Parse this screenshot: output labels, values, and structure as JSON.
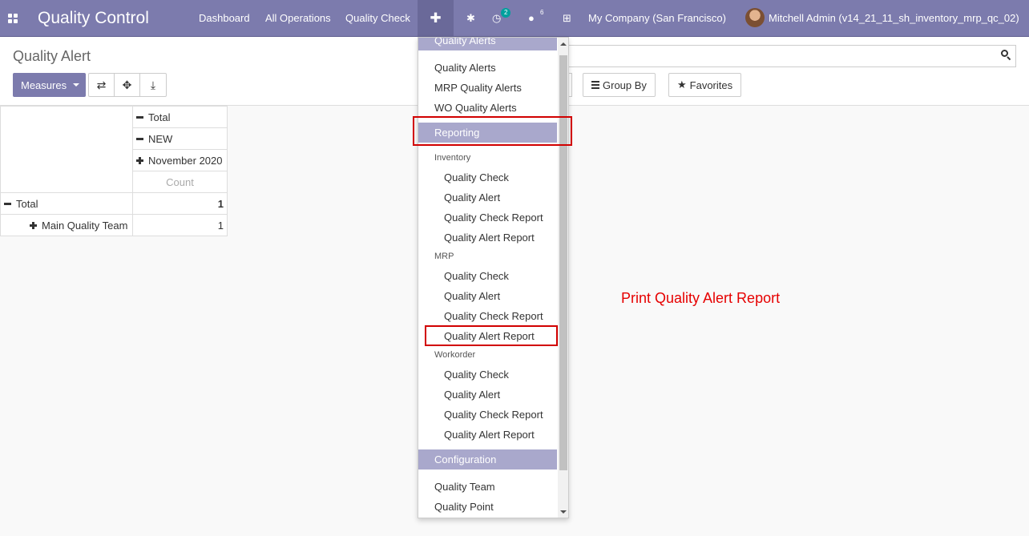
{
  "navbar": {
    "app_title": "Quality Control",
    "links": [
      "Dashboard",
      "All Operations",
      "Quality Check"
    ],
    "plus_icon": "plus-icon",
    "activity_badge": "2",
    "messages_badge": "6",
    "company": "My Company (San Francisco)",
    "user": "Mitchell Admin (v14_21_11_sh_inventory_mrp_qc_02)"
  },
  "control_panel": {
    "breadcrumb": "Quality Alert",
    "measures_label": "Measures",
    "group_by_label": "Group By",
    "favorites_label": "Favorites"
  },
  "pivot": {
    "col_headers": [
      "Total",
      "NEW",
      "November 2020"
    ],
    "measure_header": "Count",
    "rows": [
      {
        "label": "Total",
        "value": "1"
      },
      {
        "label": "Main Quality Team",
        "value": "1"
      }
    ]
  },
  "dropdown": {
    "cut_header": "Quality Alerts",
    "alerts_items": [
      "Quality Alerts",
      "MRP Quality Alerts",
      "WO Quality Alerts"
    ],
    "reporting_header": "Reporting",
    "groups": [
      {
        "label": "Inventory",
        "items": [
          "Quality Check",
          "Quality Alert",
          "Quality Check Report",
          "Quality Alert Report"
        ]
      },
      {
        "label": "MRP",
        "items": [
          "Quality Check",
          "Quality Alert",
          "Quality Check Report",
          "Quality Alert Report"
        ]
      },
      {
        "label": "Workorder",
        "items": [
          "Quality Check",
          "Quality Alert",
          "Quality Check Report",
          "Quality Alert Report"
        ]
      }
    ],
    "configuration_header": "Configuration",
    "config_items": [
      "Quality Team",
      "Quality Point"
    ]
  },
  "annotation": {
    "text": "Print Quality Alert Report",
    "color": "#e60000"
  },
  "colors": {
    "navbar": "#7c7bad",
    "menu_header": "#a9a8cc",
    "highlight": "#d10000"
  }
}
